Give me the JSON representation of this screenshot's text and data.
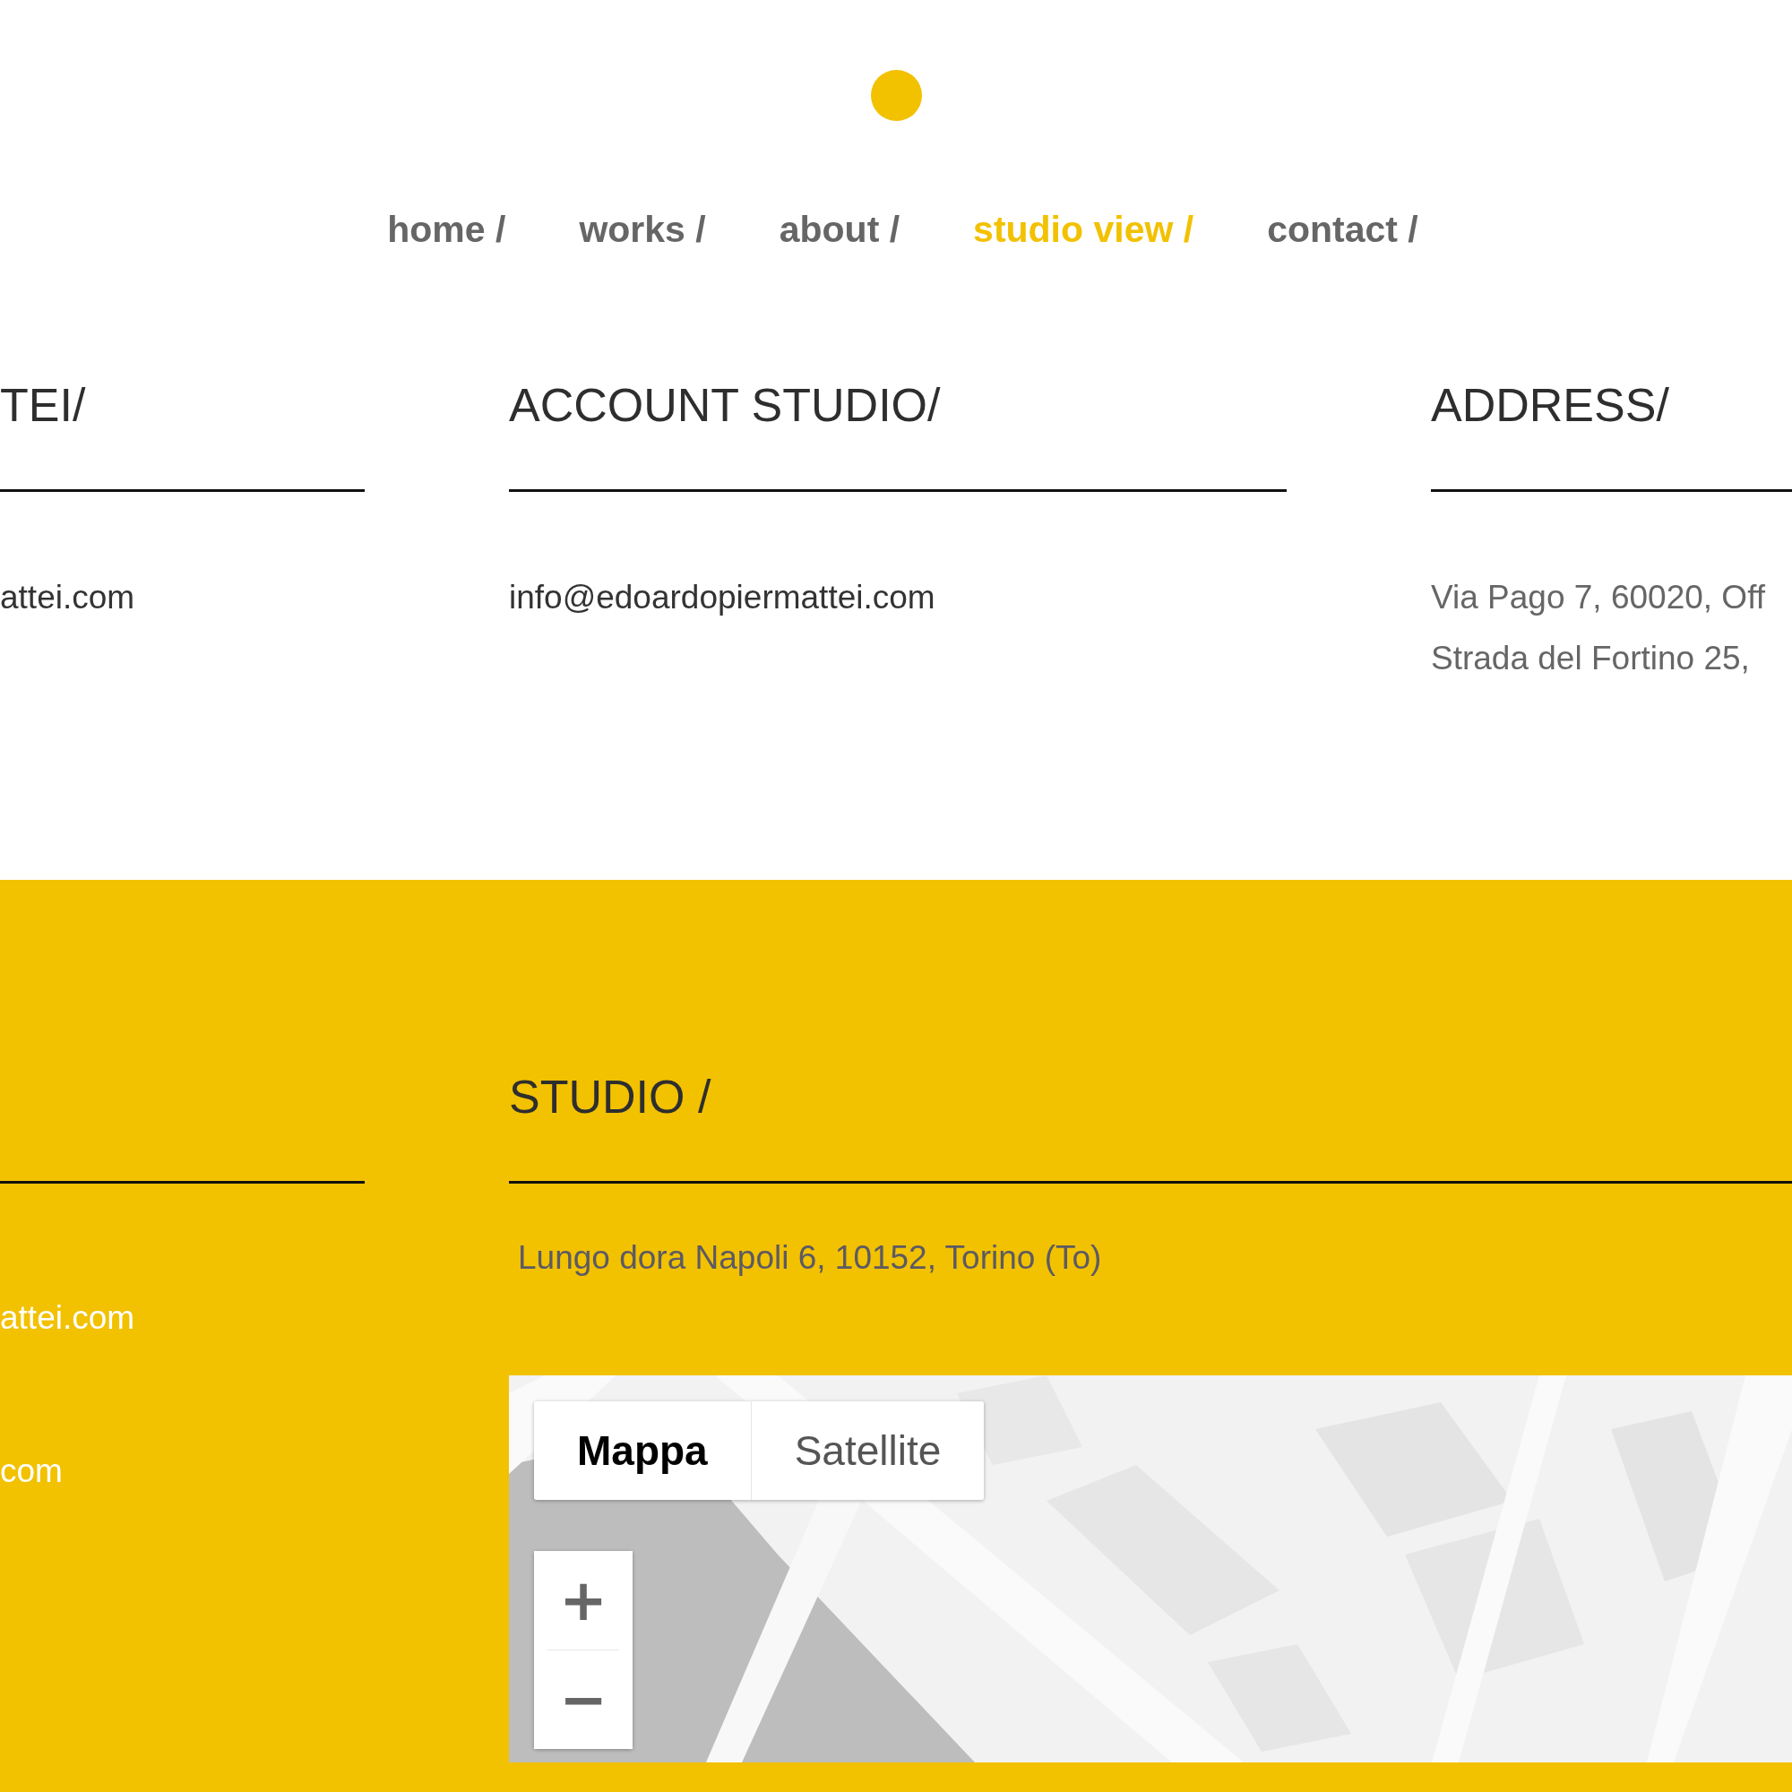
{
  "nav": [
    {
      "label": "home /",
      "selected": false
    },
    {
      "label": "works /",
      "selected": false
    },
    {
      "label": "about /",
      "selected": false
    },
    {
      "label": "studio view /",
      "selected": true
    },
    {
      "label": "contact /",
      "selected": false
    }
  ],
  "contacts": [
    {
      "heading": "TEI/",
      "lines": [
        "attei.com"
      ]
    },
    {
      "heading": "ACCOUNT STUDIO/",
      "lines": [
        "info@edoardopiermattei.com"
      ]
    },
    {
      "heading": "ADDRESS/",
      "lines": [
        "Via Pago 7, 60020, Off",
        "Strada del Fortino 25,"
      ]
    }
  ],
  "studio": {
    "side_lines": [
      "attei.com",
      "com"
    ],
    "heading": "STUDIO /",
    "address": "Lungo dora Napoli 6, 10152, Torino (To)",
    "map": {
      "kind": "picture",
      "map_type": [
        {
          "label": "Mappa",
          "selected": true
        },
        {
          "label": "Satellite",
          "selected": false
        }
      ],
      "zoom": [
        "+",
        "−"
      ]
    }
  }
}
